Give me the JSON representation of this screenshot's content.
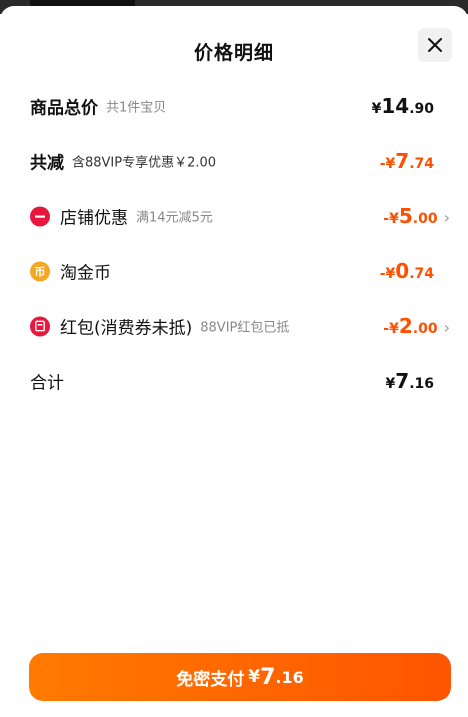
{
  "header": {
    "title": "价格明细",
    "close_label": "close"
  },
  "rows": {
    "total": {
      "label": "商品总价",
      "sub": "共1件宝贝",
      "currency": "¥",
      "int": "14",
      "dec": ".90"
    },
    "reduce": {
      "label": "共减",
      "sub": "含88VIP专享优惠￥2.00",
      "currency": "-¥",
      "int": "7",
      "dec": ".74"
    },
    "shop": {
      "label": "店铺优惠",
      "sub": "满14元减5元",
      "currency": "-¥",
      "int": "5",
      "dec": ".00",
      "icon_color": "#e8173c"
    },
    "coin": {
      "label": "淘金币",
      "currency": "-¥",
      "int": "0",
      "dec": ".74",
      "icon_color": "#f5a623",
      "icon_glyph": "币"
    },
    "redpack": {
      "label": "红包(消费券未抵)",
      "sub": "88VIP红包已抵",
      "currency": "-¥",
      "int": "2",
      "dec": ".00",
      "icon_color": "#e8173c"
    },
    "sum": {
      "label": "合计",
      "currency": "¥",
      "int": "7",
      "dec": ".16"
    }
  },
  "pay_button": {
    "label": "免密支付",
    "currency": "¥",
    "int": "7",
    "dec": ".16"
  },
  "colors": {
    "accent": "#ff5000",
    "button_start": "#ff7a00",
    "button_end": "#ff5500"
  }
}
